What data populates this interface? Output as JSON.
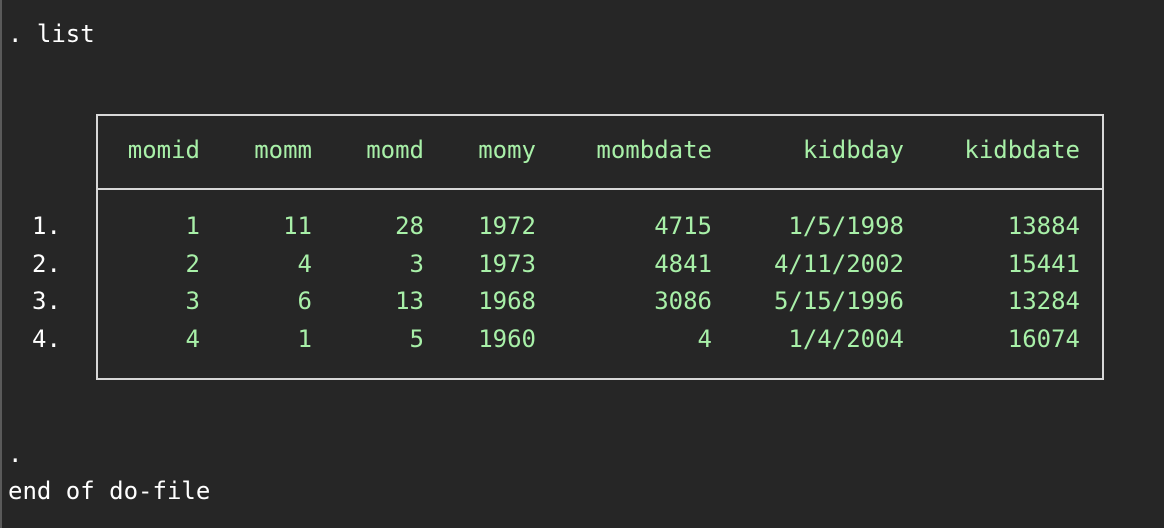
{
  "console": {
    "command_line": ". list",
    "end_prompt": ".",
    "end_message": "end of do-file"
  },
  "table": {
    "columns": [
      "momid",
      "momm",
      "momd",
      "momy",
      "mombdate",
      "kidbday",
      "kidbdate"
    ],
    "rows": [
      {
        "num": "1.",
        "cells": [
          "1",
          "11",
          "28",
          "1972",
          "4715",
          "1/5/1998",
          "13884"
        ]
      },
      {
        "num": "2.",
        "cells": [
          "2",
          "4",
          "3",
          "1973",
          "4841",
          "4/11/2002",
          "15441"
        ]
      },
      {
        "num": "3.",
        "cells": [
          "3",
          "6",
          "13",
          "1968",
          "3086",
          "5/15/1996",
          "13284"
        ]
      },
      {
        "num": "4.",
        "cells": [
          "4",
          "1",
          "5",
          "1960",
          "4",
          "1/4/2004",
          "16074"
        ]
      }
    ]
  },
  "colors": {
    "background": "#262626",
    "text": "#ffffff",
    "table_values": "#a8f0a8",
    "table_border": "#d8d8d8"
  }
}
